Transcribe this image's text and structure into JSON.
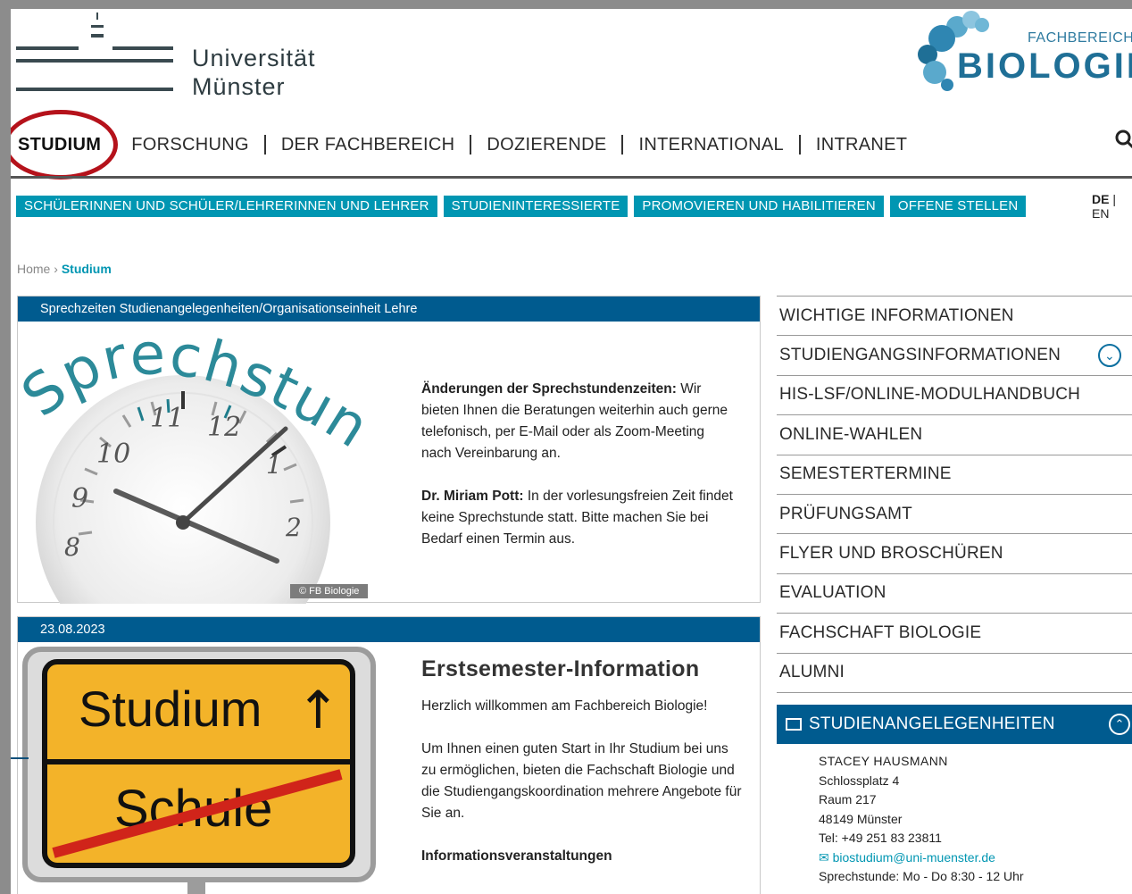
{
  "header": {
    "university_line1": "Universität",
    "university_line2": "Münster",
    "faculty_small": "FACHBEREICH",
    "faculty_big": "BIOLOGIE"
  },
  "main_nav": [
    "STUDIUM",
    "FORSCHUNG",
    "DER FACHBEREICH",
    "DOZIERENDE",
    "INTERNATIONAL",
    "INTRANET"
  ],
  "sub_nav": [
    "SCHÜLERINNEN UND SCHÜLER/LEHRERINNEN UND LEHRER",
    "STUDIENINTERESSIERTE",
    "PROMOVIEREN UND HABILITIEREN",
    "OFFENE STELLEN"
  ],
  "language": {
    "active": "DE",
    "other": "EN"
  },
  "breadcrumb": {
    "home": "Home",
    "sep": "›",
    "current": "Studium"
  },
  "box1": {
    "header": "Sprechzeiten Studienangelegenheiten/Organisationseinheit Lehre",
    "image_word": "Sprechstunde",
    "clock_numbers": [
      "8",
      "9",
      "10",
      "11",
      "12",
      "1",
      "2"
    ],
    "copyright": "© FB Biologie",
    "p1_bold": "Änderungen der Sprechstundenzeiten:",
    "p1_text": " Wir bieten Ihnen die Beratungen weiterhin auch gerne telefonisch, per E-Mail oder als Zoom-Meeting nach Vereinbarung an.",
    "p2_bold": "Dr. Miriam Pott:",
    "p2_text": " In der vorlesungsfreien Zeit findet keine Sprechstunde statt. Bitte machen Sie bei Bedarf einen Termin aus."
  },
  "box2": {
    "header": "23.08.2023",
    "sign_top": "Studium",
    "sign_arrow": "↑",
    "sign_bottom": "Schule",
    "title": "Erstsemester-Information",
    "p1": "Herzlich willkommen am Fachbereich Biologie!",
    "p2": "Um Ihnen einen guten Start in Ihr Studium bei uns zu ermöglichen, bieten die Fachschaft Biologie und die Studiengangskoordination mehrere Angebote für Sie an.",
    "p3": "Informationsveranstaltungen"
  },
  "side_menu": [
    "WICHTIGE INFORMATIONEN",
    "STUDIENGANGSINFORMATIONEN",
    "HIS-LSF/ONLINE-MODULHANDBUCH",
    "ONLINE-WAHLEN",
    "SEMESTERTERMINE",
    "PRÜFUNGSAMT",
    "FLYER UND BROSCHÜREN",
    "EVALUATION",
    "FACHSCHAFT BIOLOGIE",
    "ALUMNI"
  ],
  "contact": {
    "title": "STUDIENANGELEGENHEITEN",
    "name": "STACEY HAUSMANN",
    "street": "Schlossplatz 4",
    "room": "Raum 217",
    "city": "48149 Münster",
    "phone": "Tel: +49 251 83 23811",
    "email": "biostudium@uni-muenster.de",
    "hours": "Sprechstunde: Mo - Do 8:30 - 12 Uhr"
  },
  "colors": {
    "teal": "#0096b2",
    "navy": "#005b8f",
    "highlight_circle": "#b5121b",
    "sign_yellow": "#f3b329"
  }
}
